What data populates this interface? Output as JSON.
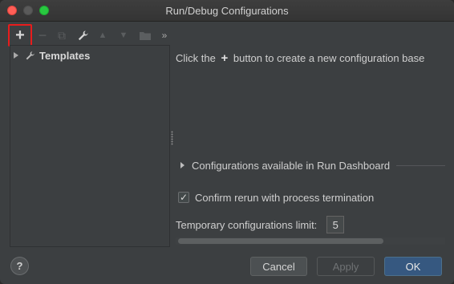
{
  "window": {
    "title": "Run/Debug Configurations"
  },
  "toolbar": {
    "add_label": "+",
    "remove_label": "−",
    "copy_label": "⧉",
    "edit_label": "🔧",
    "up_label": "▲",
    "down_label": "▼",
    "folder_label": "▣",
    "more_label": "»"
  },
  "tree": {
    "items": [
      {
        "label": "Templates",
        "icon": "wrench-icon"
      }
    ]
  },
  "content": {
    "hint_before": "Click the",
    "hint_plus": "+",
    "hint_after": "button to create a new configuration base",
    "dashboard_label": "Configurations available in Run Dashboard",
    "confirm_label": "Confirm rerun with process termination",
    "confirm_checked": true,
    "limit_label": "Temporary configurations limit:",
    "limit_value": "5"
  },
  "footer": {
    "help_label": "?",
    "cancel_label": "Cancel",
    "apply_label": "Apply",
    "ok_label": "OK"
  },
  "colors": {
    "accent_ok": "#365880",
    "highlight_box": "#e81c1c",
    "background": "#3c3f41"
  }
}
